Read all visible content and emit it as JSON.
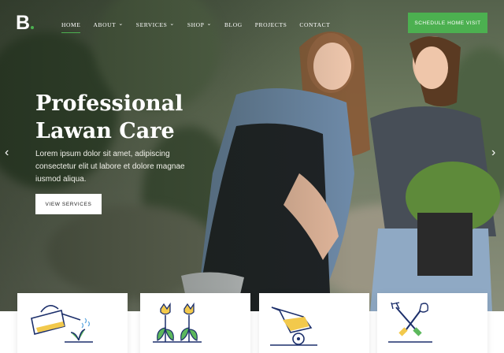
{
  "brand": {
    "logo_letter": "B"
  },
  "nav": {
    "items": [
      {
        "label": "HOME",
        "active": true,
        "dropdown": false
      },
      {
        "label": "ABOUT",
        "active": false,
        "dropdown": true
      },
      {
        "label": "SERVICES",
        "active": false,
        "dropdown": true
      },
      {
        "label": "SHOP",
        "active": false,
        "dropdown": true
      },
      {
        "label": "BLOG",
        "active": false,
        "dropdown": false
      },
      {
        "label": "PROJECTS",
        "active": false,
        "dropdown": false
      },
      {
        "label": "CONTACT",
        "active": false,
        "dropdown": false
      }
    ],
    "cta_label": "SCHEDULE HOME VISIT"
  },
  "hero": {
    "title_line1": "Professional",
    "title_line2": "Lawan Care",
    "body": "Lorem ipsum dolor sit amet, adipiscing consectetur elit ut labore et dolore magnae iusmod aliqua.",
    "button_label": "VIEW SERVICES",
    "prev_arrow": "‹",
    "next_arrow": "›"
  },
  "cards": [
    {
      "icon": "watering-can-icon"
    },
    {
      "icon": "flowers-icon"
    },
    {
      "icon": "wheelbarrow-icon"
    },
    {
      "icon": "garden-tools-icon"
    }
  ],
  "colors": {
    "accent": "#4cb050",
    "icon_blue": "#1c2f6b",
    "icon_yellow": "#f2c94c",
    "icon_green": "#5cb85c"
  }
}
